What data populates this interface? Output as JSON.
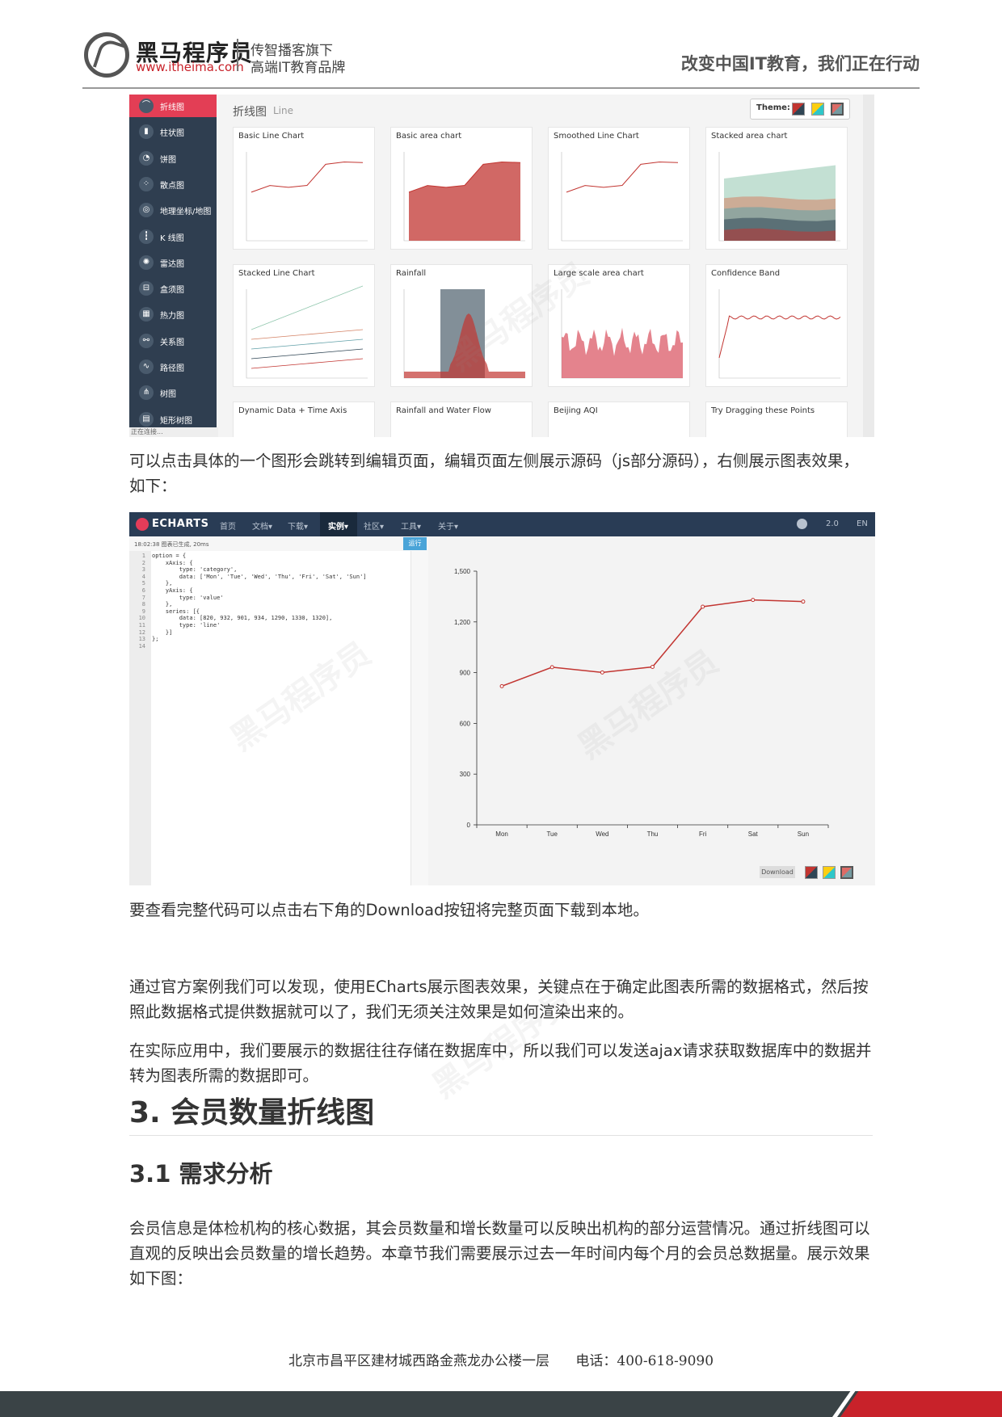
{
  "header": {
    "brand_name": "黑马程序员",
    "brand_url": "www.itheima.com",
    "slogan_line1": "传智播客旗下",
    "slogan_line2": "高端IT教育品牌",
    "motto": "改变中国IT教育，我们正在行动"
  },
  "gallery": {
    "sidebar": [
      {
        "label": "折线图",
        "icon": "line-chart-icon",
        "glyph": "⌒"
      },
      {
        "label": "柱状图",
        "icon": "bar-chart-icon",
        "glyph": "▮"
      },
      {
        "label": "饼图",
        "icon": "pie-chart-icon",
        "glyph": "◔"
      },
      {
        "label": "散点图",
        "icon": "scatter-icon",
        "glyph": "⁘"
      },
      {
        "label": "地理坐标/地图",
        "icon": "map-icon",
        "glyph": "◎"
      },
      {
        "label": "K 线图",
        "icon": "candlestick-icon",
        "glyph": "┇"
      },
      {
        "label": "雷达图",
        "icon": "radar-icon",
        "glyph": "✺"
      },
      {
        "label": "盒须图",
        "icon": "boxplot-icon",
        "glyph": "⊟"
      },
      {
        "label": "热力图",
        "icon": "heatmap-icon",
        "glyph": "▦"
      },
      {
        "label": "关系图",
        "icon": "graph-icon",
        "glyph": "⚯"
      },
      {
        "label": "路径图",
        "icon": "lines-icon",
        "glyph": "∿"
      },
      {
        "label": "树图",
        "icon": "tree-icon",
        "glyph": "⋔"
      },
      {
        "label": "矩形树图",
        "icon": "treemap-icon",
        "glyph": "▤"
      }
    ],
    "status": "正在连接...",
    "title": "折线图",
    "title_en": "Line",
    "theme_label": "Theme:",
    "cards": [
      "Basic Line Chart",
      "Basic area chart",
      "Smoothed Line Chart",
      "Stacked area chart",
      "Stacked Line Chart",
      "Rainfall",
      "Large scale area chart",
      "Confidence Band",
      "Dynamic Data + Time Axis",
      "Rainfall and Water Flow",
      "Beijing AQI",
      "Try Dragging these Points"
    ]
  },
  "paragraphs": {
    "p1": "可以点击具体的一个图形会跳转到编辑页面，编辑页面左侧展示源码（js部分源码），右侧展示图表效果，如下：",
    "p2": "要查看完整代码可以点击右下角的Download按钮将完整页面下载到本地。",
    "p3": "通过官方案例我们可以发现，使用ECharts展示图表效果，关键点在于确定此图表所需的数据格式，然后按照此数据格式提供数据就可以了，我们无须关注效果是如何渲染出来的。",
    "p4": "在实际应用中，我们要展示的数据往往存储在数据库中，所以我们可以发送ajax请求获取数据库中的数据并转为图表所需的数据即可。",
    "p5": "会员信息是体检机构的核心数据，其会员数量和增长数量可以反映出机构的部分运营情况。通过折线图可以直观的反映出会员数量的增长趋势。本章节我们需要展示过去一年时间内每个月的会员总数据量。展示效果如下图："
  },
  "editor": {
    "logo_text": "ECHARTS",
    "nav": [
      "首页",
      "文档▾",
      "下载▾",
      "实例▾",
      "社区▾",
      "工具▾",
      "关于▾"
    ],
    "nav_right": [
      "2.0",
      "EN"
    ],
    "code_bar_text": "18:02:38  图表已生成, 20ms",
    "run_label": "运行",
    "code_lines": [
      "option = {",
      "    xAxis: {",
      "        type: 'category',",
      "        data: ['Mon', 'Tue', 'Wed', 'Thu', 'Fri', 'Sat', 'Sun']",
      "    },",
      "    yAxis: {",
      "        type: 'value'",
      "    },",
      "    series: [{",
      "        data: [820, 932, 901, 934, 1290, 1330, 1320],",
      "        type: 'line'",
      "    }]",
      "};",
      ""
    ],
    "download_label": "Download"
  },
  "chart_data": {
    "type": "line",
    "categories": [
      "Mon",
      "Tue",
      "Wed",
      "Thu",
      "Fri",
      "Sat",
      "Sun"
    ],
    "values": [
      820,
      932,
      901,
      934,
      1290,
      1330,
      1320
    ],
    "y_ticks": [
      "0",
      "300",
      "600",
      "900",
      "1,200",
      "1,500"
    ],
    "ylim": [
      0,
      1500
    ],
    "line_color": "#c23531",
    "grid": false
  },
  "headings": {
    "h1": "3. 会员数量折线图",
    "h2": "3.1 需求分析"
  },
  "footer": {
    "address": "北京市昌平区建材城西路金燕龙办公楼一层",
    "phone": "电话：400-618-9090"
  },
  "watermark": {
    "brand": "黑马程序员",
    "url": "www.itheima.com"
  }
}
